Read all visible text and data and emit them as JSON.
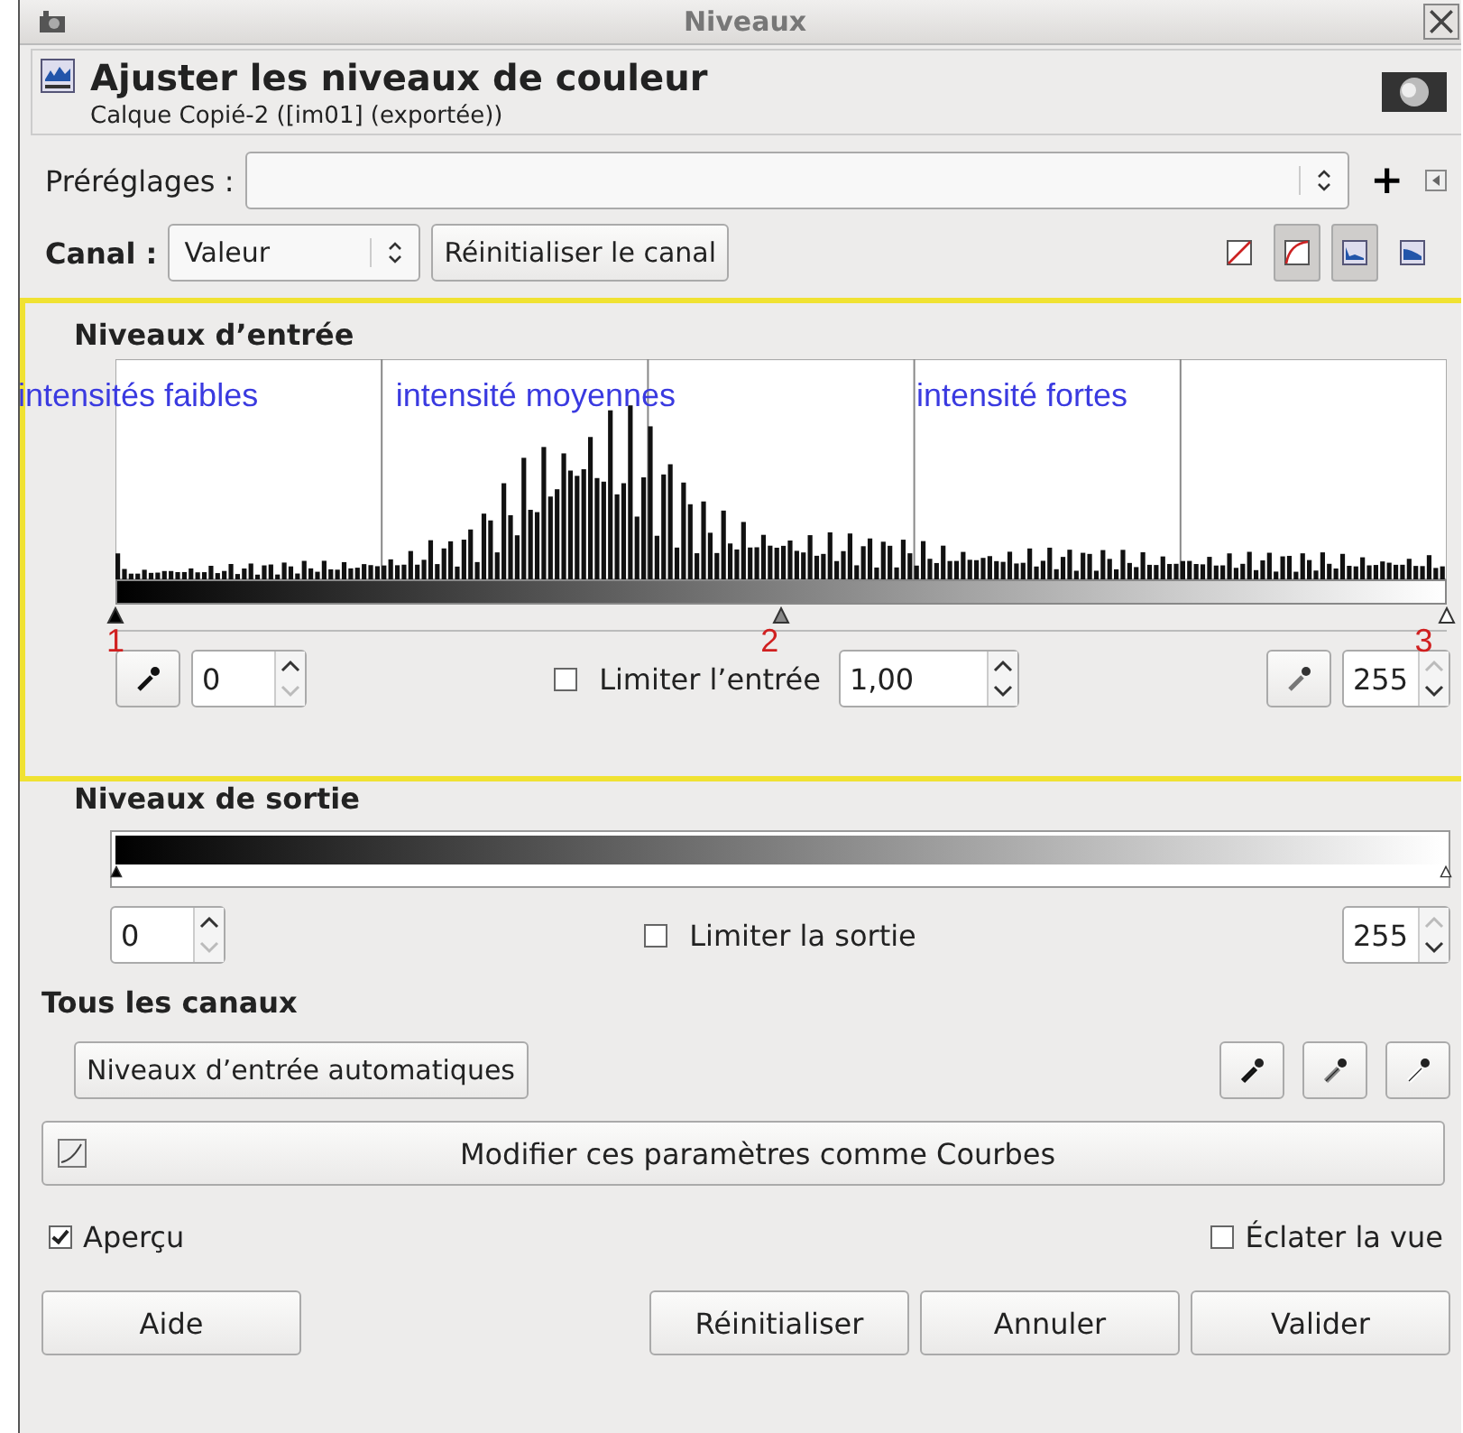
{
  "window": {
    "title": "Niveaux"
  },
  "header": {
    "title": "Ajuster les niveaux de couleur",
    "subtitle": "Calque Copié-2 ([im01] (exportée))"
  },
  "presets": {
    "label": "Préréglages :",
    "add": "+"
  },
  "channel": {
    "label": "Canal :",
    "value": "Valeur",
    "reset": "Réinitialiser le canal",
    "scale_buttons": [
      {
        "kind": "linear",
        "selected": false
      },
      {
        "kind": "log",
        "selected": true
      }
    ],
    "display_buttons": [
      {
        "kind": "linear",
        "selected": true
      },
      {
        "kind": "log",
        "selected": false
      }
    ]
  },
  "input_levels": {
    "heading": "Niveaux d’entrée",
    "annotations": [
      "intensités faibles",
      "intensité moyennes",
      "intensité fortes"
    ],
    "markers": [
      "1",
      "2",
      "3"
    ],
    "handles": [
      {
        "kind": "black",
        "level": 0
      },
      {
        "kind": "gamma",
        "level": 0.5
      },
      {
        "kind": "white",
        "level": 1
      }
    ],
    "low": "0",
    "gamma": "1,00",
    "high": "255",
    "clamp": {
      "label": "Limiter l’entrée",
      "checked": false
    }
  },
  "output_levels": {
    "heading": "Niveaux de sortie",
    "handles": [
      {
        "kind": "black",
        "level": 0
      },
      {
        "kind": "white",
        "level": 1
      }
    ],
    "low": "0",
    "high": "255",
    "clamp": {
      "label": "Limiter la sortie",
      "checked": false
    }
  },
  "all_channels": {
    "heading": "Tous les canaux",
    "auto": "Niveaux d’entrée automatiques",
    "pickers": [
      {
        "kind": "black"
      },
      {
        "kind": "gray"
      },
      {
        "kind": "white"
      }
    ]
  },
  "curves_button": "Modifier ces paramètres comme Courbes",
  "preview": {
    "label": "Aperçu",
    "checked": true
  },
  "split": {
    "label": "Éclater la vue",
    "checked": false
  },
  "buttons": [
    "Aide",
    "Réinitialiser",
    "Annuler",
    "Valider"
  ]
}
